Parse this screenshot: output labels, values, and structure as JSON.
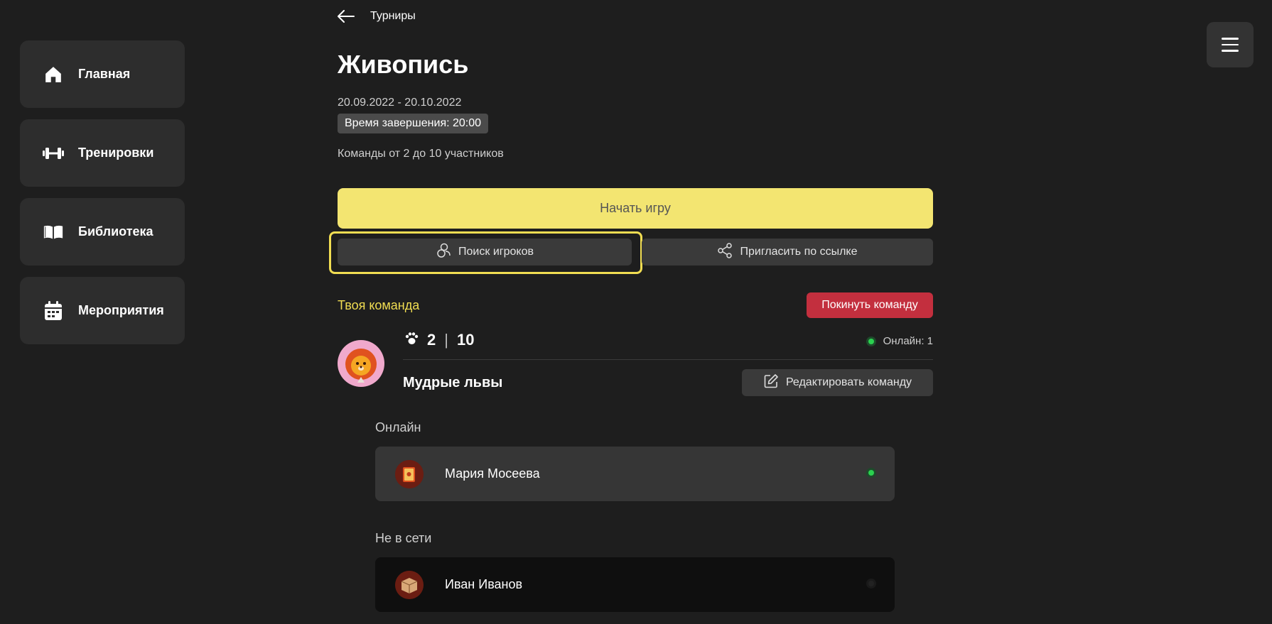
{
  "sidebar": {
    "items": [
      {
        "label": "Главная",
        "icon": "home-icon"
      },
      {
        "label": "Тренировки",
        "icon": "dumbbell-icon"
      },
      {
        "label": "Библиотека",
        "icon": "book-icon"
      },
      {
        "label": "Мероприятия",
        "icon": "calendar-icon"
      }
    ]
  },
  "header": {
    "breadcrumb": "Турниры",
    "title": "Живопись",
    "dates": "20.09.2022 - 20.10.2022",
    "end_time": "Время завершения: 20:00",
    "team_size": "Команды от 2 до 10 участников"
  },
  "actions": {
    "start_game": "Начать игру",
    "search_players": "Поиск игроков",
    "invite_link": "Пригласить по ссылке"
  },
  "team": {
    "section_title": "Твоя команда",
    "leave_label": "Покинуть команду",
    "members_current": "2",
    "members_separator": "|",
    "members_max": "10",
    "online_label": "Онлайн: 1",
    "name": "Мудрые львы",
    "edit_label": "Редактировать команду"
  },
  "members": {
    "online_title": "Онлайн",
    "offline_title": "Не в сети",
    "online": [
      {
        "name": "Мария Мосеева"
      }
    ],
    "offline": [
      {
        "name": "Иван Иванов"
      }
    ]
  },
  "colors": {
    "accent_yellow": "#f3e571",
    "danger_red": "#c32f3e",
    "online_green": "#2bd14f",
    "background": "#1e1e1e"
  }
}
